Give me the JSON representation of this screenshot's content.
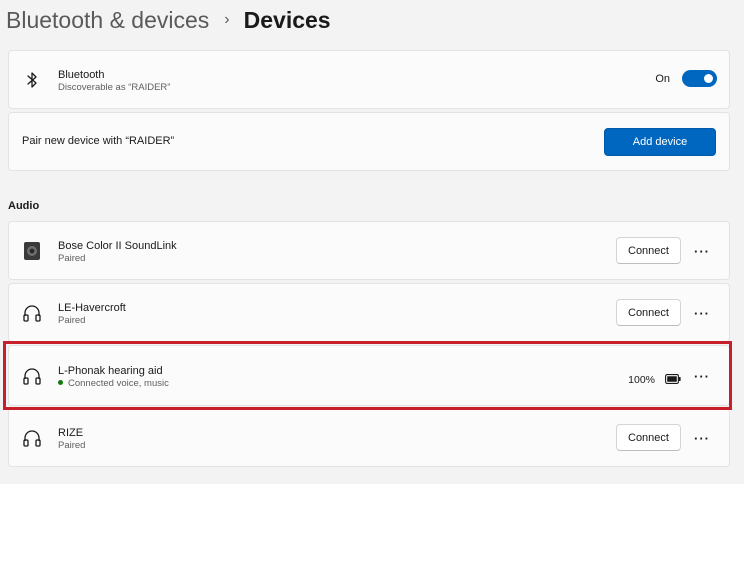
{
  "breadcrumb": {
    "parent": "Bluetooth & devices",
    "separator": "›",
    "current": "Devices"
  },
  "bluetooth": {
    "title": "Bluetooth",
    "subtitle": "Discoverable as “RAIDER”",
    "toggle_label": "On",
    "toggle_on": true,
    "icon": "bluetooth-icon"
  },
  "pairing": {
    "label": "Pair new device with “RAIDER”",
    "button": "Add device"
  },
  "audio_section": {
    "label": "Audio",
    "devices": [
      {
        "name": "Bose Color II SoundLink",
        "status": "Paired",
        "action": "Connect",
        "more": "···",
        "icon": "speaker-icon"
      },
      {
        "name": "LE-Havercroft",
        "status": "Paired",
        "action": "Connect",
        "more": "···",
        "icon": "headphones-icon"
      },
      {
        "name": "L-Phonak hearing aid",
        "status": "Connected voice, music",
        "battery": "100%",
        "more": "···",
        "icon": "headphones-icon",
        "highlighted": true
      },
      {
        "name": "RIZE",
        "status": "Paired",
        "action": "Connect",
        "more": "···",
        "icon": "headphones-icon"
      }
    ]
  },
  "colors": {
    "accent": "#0067c0",
    "highlight": "#c8202b",
    "connected_dot": "#107c10"
  }
}
